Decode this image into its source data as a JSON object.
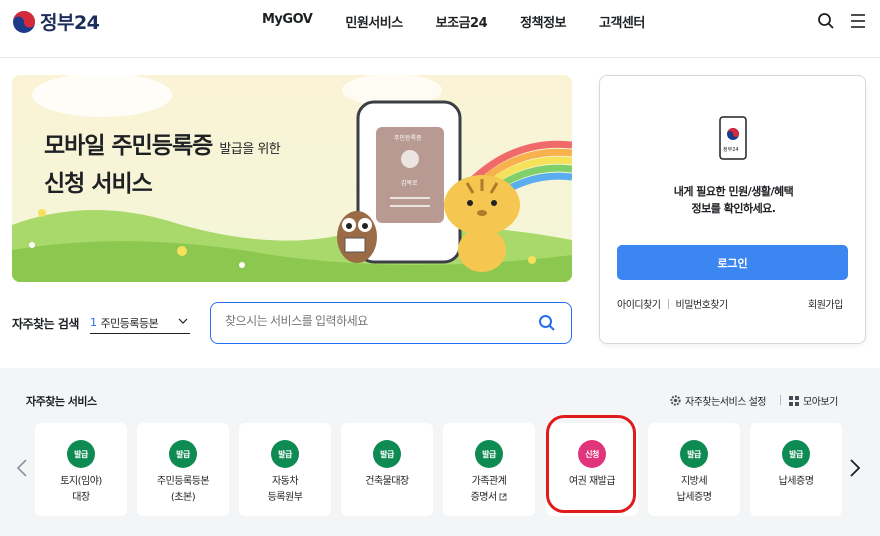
{
  "header": {
    "logo_text": "정부24",
    "nav": [
      "MyGOV",
      "민원서비스",
      "보조금24",
      "정책정보",
      "고객센터"
    ],
    "icons": [
      "search-icon",
      "menu-icon"
    ]
  },
  "banner": {
    "title_main": "모바일 주민등록증",
    "title_small": "발급을 위한",
    "title_line2": "신청 서비스",
    "card_label": "주민등록증",
    "card_name": "김복로"
  },
  "search": {
    "freq_label": "자주찾는 검색",
    "rank": "1",
    "selected": "주민등록등본",
    "placeholder": "찾으시는 서비스를 입력하세요"
  },
  "login_card": {
    "phone_label": "정부24",
    "message_line1": "내게 필요한 민원/생활/혜택",
    "message_line2": "정보를 확인하세요.",
    "login_button": "로그인",
    "find_id": "아이디찾기",
    "find_password": "비밀번호찾기",
    "join": "회원가입"
  },
  "services": {
    "title": "자주찾는 서비스",
    "settings": "자주찾는서비스 설정",
    "view_all": "모아보기",
    "colors": {
      "issue": "#0e8a53",
      "apply": "#e0357a",
      "highlight": "#e01b1b"
    },
    "items": [
      {
        "badge": "발급",
        "line1": "토지(임야)",
        "line2": "대장"
      },
      {
        "badge": "발급",
        "line1": "주민등록등본",
        "line2": "(초본)"
      },
      {
        "badge": "발급",
        "line1": "자동차",
        "line2": "등록원부"
      },
      {
        "badge": "발급",
        "line1": "건축물대장",
        "line2": ""
      },
      {
        "badge": "발급",
        "line1": "가족관계",
        "line2": "증명서"
      },
      {
        "badge": "신청",
        "line1": "여권 재발급",
        "line2": ""
      },
      {
        "badge": "발급",
        "line1": "지방세",
        "line2": "납세증명"
      },
      {
        "badge": "발급",
        "line1": "납세증명",
        "line2": ""
      }
    ]
  }
}
